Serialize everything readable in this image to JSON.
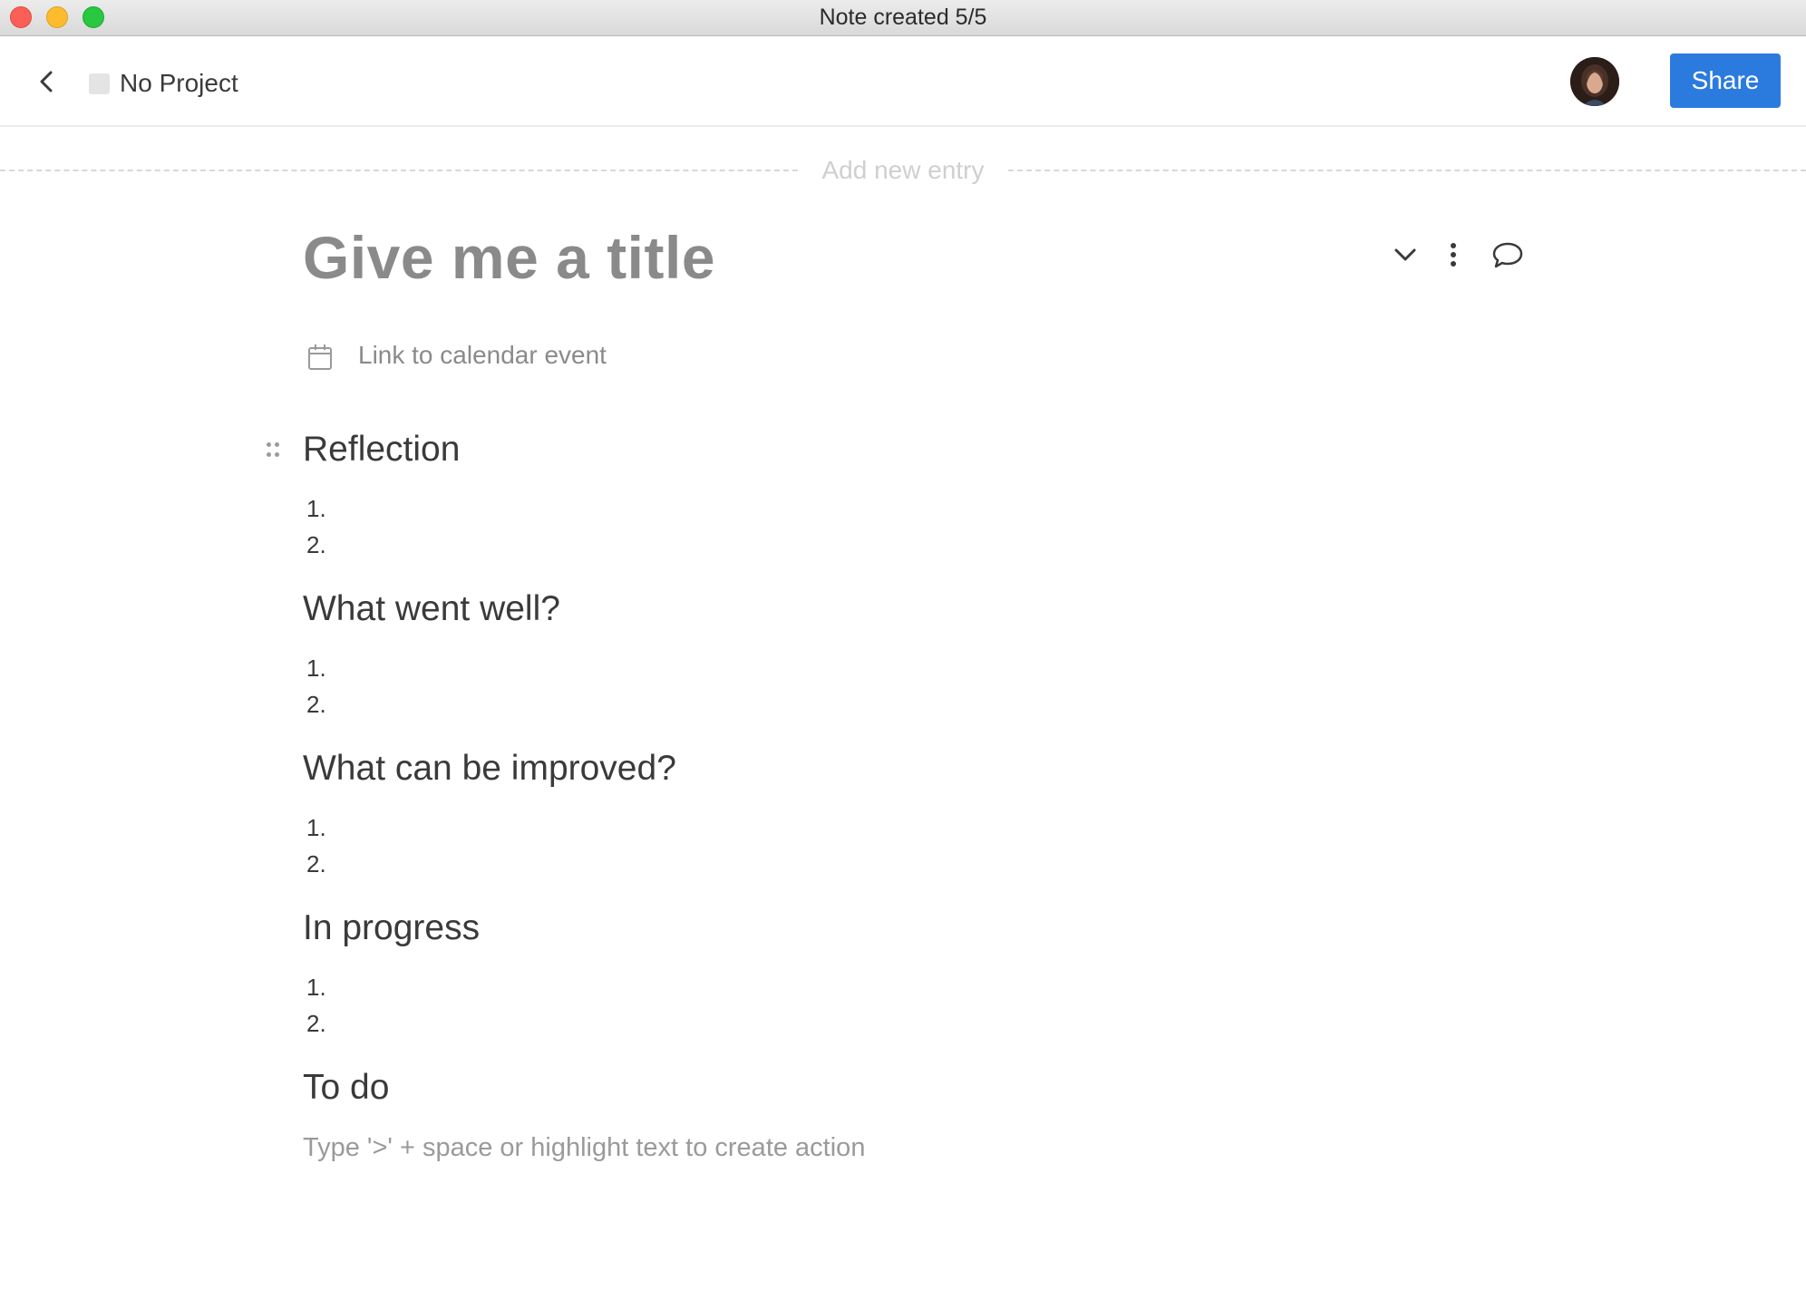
{
  "window": {
    "title": "Note created 5/5"
  },
  "header": {
    "project_label": "No Project",
    "share_label": "Share"
  },
  "add_entry": {
    "label": "Add new entry"
  },
  "note": {
    "title_placeholder": "Give me a title",
    "calendar_link_label": "Link to calendar event",
    "sections": [
      {
        "heading": "Reflection",
        "items": [
          "1.",
          "2."
        ]
      },
      {
        "heading": "What went well?",
        "items": [
          "1.",
          "2."
        ]
      },
      {
        "heading": "What can be improved?",
        "items": [
          "1.",
          "2."
        ]
      },
      {
        "heading": "In progress",
        "items": [
          "1.",
          "2."
        ]
      },
      {
        "heading": "To do",
        "hint": "Type '>' + space or highlight text to create action"
      }
    ]
  },
  "icons": {
    "back": "chevron-left-icon",
    "collapse": "chevron-down-icon",
    "more": "more-vertical-icon",
    "comment": "comment-icon",
    "calendar": "calendar-icon",
    "drag": "drag-handle-icon"
  },
  "colors": {
    "accent": "#2b7bdf",
    "title_placeholder": "#8a8a8a",
    "muted": "#cfcfcf"
  }
}
